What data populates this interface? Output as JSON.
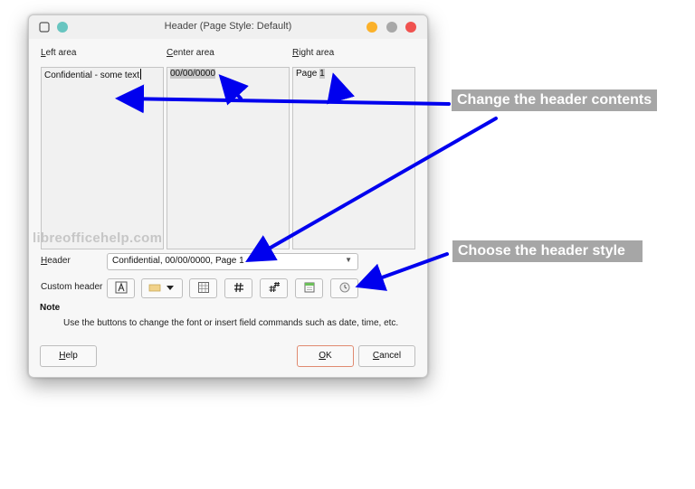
{
  "dialog": {
    "title": "Header (Page Style: Default)",
    "areas": [
      {
        "label_mnemonic": "L",
        "label_rest": "eft area",
        "content": "Confidential - some text",
        "selected": ""
      },
      {
        "label_mnemonic": "C",
        "label_rest": "enter area",
        "content": "",
        "selected": "00/00/0000"
      },
      {
        "label_mnemonic": "R",
        "label_rest": "ight area",
        "content": "Page ",
        "selected": "1"
      }
    ],
    "header_label_mnemonic": "H",
    "header_label_rest": "eader",
    "header_value": "Confidential, 00/00/0000, Page 1",
    "custom_header_label": "Custom header",
    "note_title": "Note",
    "note_text": "Use the buttons to change the font or insert field commands such as date, time, etc.",
    "buttons": {
      "help_mnemonic": "H",
      "help_rest": "elp",
      "ok_mnemonic": "O",
      "ok_rest": "K",
      "cancel_mnemonic": "C",
      "cancel_rest": "ancel"
    },
    "tools": [
      "text-attributes-icon",
      "color-dropdown-icon",
      "title-field-icon",
      "page-number-icon",
      "page-count-icon",
      "date-icon",
      "time-icon"
    ]
  },
  "watermark": "libreofficehelp.com",
  "callouts": {
    "contents": "Change the header contents",
    "style": "Choose the header style"
  },
  "colors": {
    "arrow": "#0000ee",
    "callout_bg": "#a6a6a6",
    "close_btn": "#f0524f",
    "minimize_btn": "#fbb12a",
    "maximize_btn": "#a8a8a8",
    "pin_btn": "#68c5c0"
  }
}
